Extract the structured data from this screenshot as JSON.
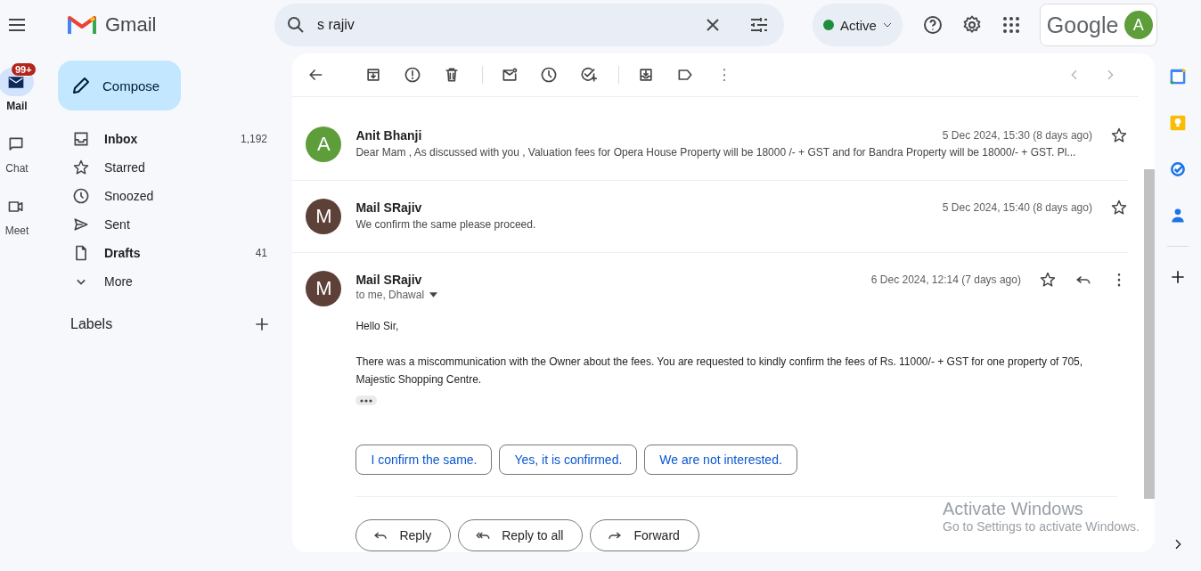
{
  "brand": "Gmail",
  "search": {
    "value": "s rajiv"
  },
  "status": {
    "label": "Active"
  },
  "account": {
    "logo": "Google",
    "avatar": "A"
  },
  "rail": [
    {
      "label": "Mail",
      "selected": true,
      "badge": "99+"
    },
    {
      "label": "Chat",
      "selected": false
    },
    {
      "label": "Meet",
      "selected": false
    }
  ],
  "compose": "Compose",
  "folders": [
    {
      "label": "Inbox",
      "count": "1,192",
      "unread": true
    },
    {
      "label": "Starred",
      "unread": false
    },
    {
      "label": "Snoozed",
      "unread": false
    },
    {
      "label": "Sent",
      "unread": false
    },
    {
      "label": "Drafts",
      "count": "41",
      "unread": true
    },
    {
      "label": "More",
      "unread": false
    }
  ],
  "labels_heading": "Labels",
  "messages": [
    {
      "sender": "Anit Bhanji",
      "avatar": "A",
      "color": "#5e9e3a",
      "date": "5 Dec 2024, 15:30 (8 days ago)",
      "snippet": "Dear Mam , As discussed with you , Valuation fees for Opera House Property will be 18000 /- + GST and for Bandra Property will be 18000/- + GST. Pl..."
    },
    {
      "sender": "Mail SRajiv",
      "avatar": "M",
      "color": "#5d4037",
      "date": "5 Dec 2024, 15:40 (8 days ago)",
      "snippet": "We confirm the same please proceed."
    }
  ],
  "open_message": {
    "sender": "Mail SRajiv",
    "avatar": "M",
    "color": "#5d4037",
    "recipients": "to me, Dhawal",
    "date": "6 Dec 2024, 12:14 (7 days ago)",
    "body": [
      "Hello Sir,",
      "There was a miscommunication with the Owner about the fees. You are requested to kindly confirm the fees of Rs. 11000/- + GST for one property of 705, Majestic Shopping Centre."
    ]
  },
  "smart_replies": [
    "I confirm the same.",
    "Yes, it is confirmed.",
    "We are not interested."
  ],
  "actions": [
    {
      "kind": "reply",
      "label": "Reply"
    },
    {
      "kind": "reply_all",
      "label": "Reply to all"
    },
    {
      "kind": "forward",
      "label": "Forward"
    }
  ],
  "windows_notice": {
    "title": "Activate Windows",
    "subtitle": "Go to Settings to activate Windows."
  }
}
